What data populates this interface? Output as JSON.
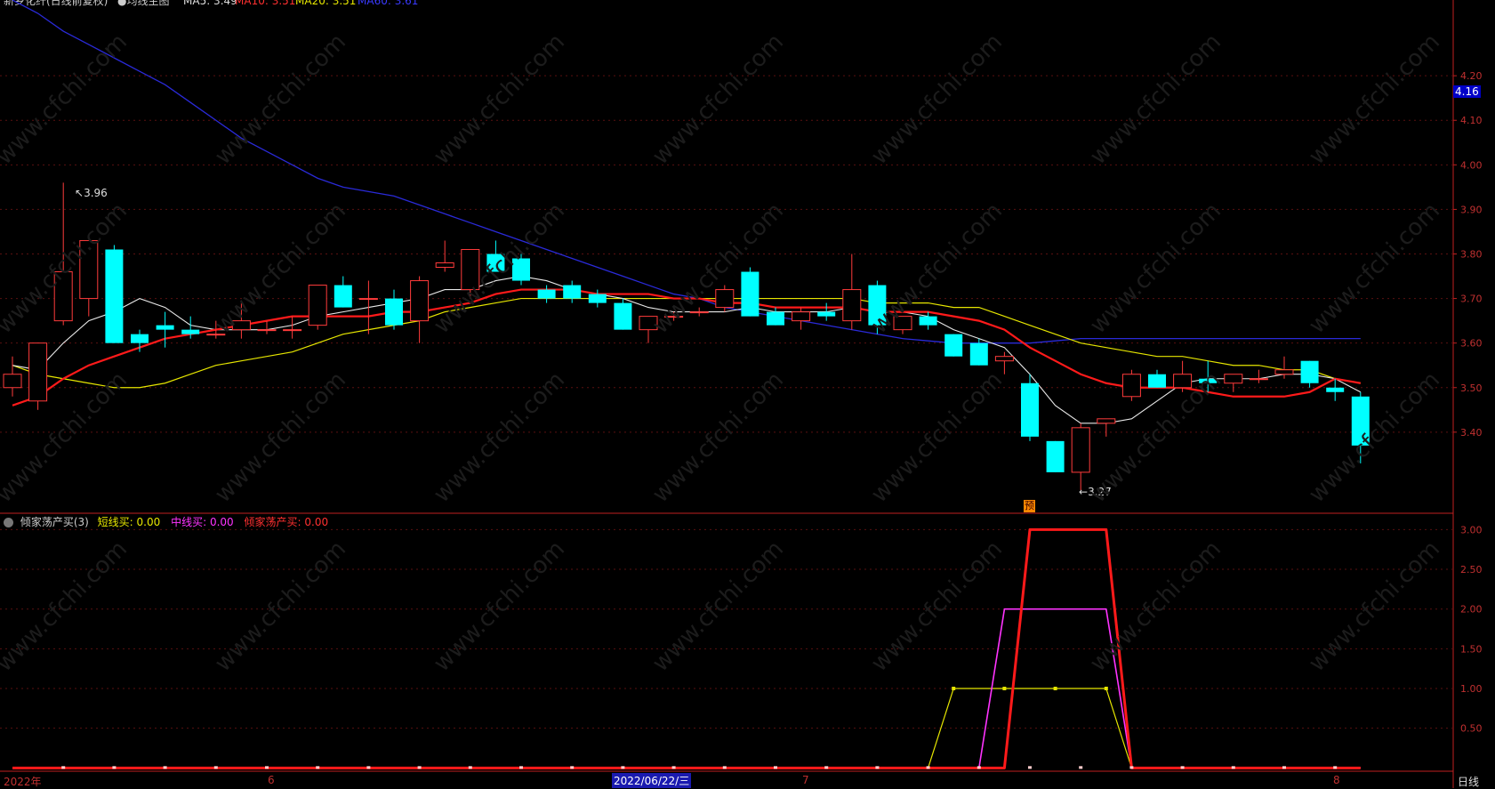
{
  "header": {
    "stock_title": "新乡化纤(日线前复权)",
    "ma_title": "●均线主图",
    "ma5_label": "MA5: 3.49",
    "ma10_label": "MA10: 3.51",
    "ma20_label": "MA20: 3.51",
    "ma60_label": "MA60: 3.61"
  },
  "price_tag": "4.16",
  "indicator": {
    "name": "倾家荡产买(3)",
    "s1_label": "短线买:",
    "s1_value": "0.00",
    "s2_label": "中线买:",
    "s2_value": "0.00",
    "s3_label": "倾家荡产买:",
    "s3_value": "0.00"
  },
  "x_axis": {
    "labels": [
      "2022年",
      "6",
      "2022/06/22/三",
      "7",
      "8"
    ],
    "period_label": "日线"
  },
  "annotations": {
    "high": "3.96",
    "low": "3.27",
    "marker": "预"
  },
  "watermark": "www.cfchi.com",
  "colors": {
    "up": "#ff3b3b",
    "down": "#00ffff",
    "ma5": "#e8e8e8",
    "ma10": "#ff1a1a",
    "ma20": "#e6e600",
    "ma60": "#2a2ad8",
    "ind_short": "#e6e600",
    "ind_mid": "#ff33ff",
    "ind_long": "#ff1a1a"
  },
  "chart_data": [
    {
      "type": "candlestick",
      "title": "",
      "y_axis_ticks": [
        3.4,
        3.5,
        3.6,
        3.7,
        3.8,
        3.9,
        4.0,
        4.1,
        4.2
      ],
      "ylim": [
        3.22,
        4.37
      ],
      "candles": [
        {
          "o": 3.5,
          "h": 3.57,
          "l": 3.48,
          "c": 3.53
        },
        {
          "o": 3.47,
          "h": 3.6,
          "l": 3.45,
          "c": 3.6
        },
        {
          "o": 3.65,
          "h": 3.96,
          "l": 3.64,
          "c": 3.76
        },
        {
          "o": 3.7,
          "h": 3.83,
          "l": 3.66,
          "c": 3.83
        },
        {
          "o": 3.81,
          "h": 3.82,
          "l": 3.6,
          "c": 3.6
        },
        {
          "o": 3.62,
          "h": 3.63,
          "l": 3.58,
          "c": 3.6
        },
        {
          "o": 3.64,
          "h": 3.67,
          "l": 3.59,
          "c": 3.63
        },
        {
          "o": 3.63,
          "h": 3.66,
          "l": 3.61,
          "c": 3.62
        },
        {
          "o": 3.62,
          "h": 3.65,
          "l": 3.61,
          "c": 3.62
        },
        {
          "o": 3.63,
          "h": 3.69,
          "l": 3.61,
          "c": 3.65
        },
        {
          "o": 3.63,
          "h": 3.65,
          "l": 3.62,
          "c": 3.63
        },
        {
          "o": 3.63,
          "h": 3.66,
          "l": 3.61,
          "c": 3.63
        },
        {
          "o": 3.64,
          "h": 3.73,
          "l": 3.63,
          "c": 3.73
        },
        {
          "o": 3.73,
          "h": 3.75,
          "l": 3.68,
          "c": 3.68
        },
        {
          "o": 3.7,
          "h": 3.74,
          "l": 3.62,
          "c": 3.7
        },
        {
          "o": 3.7,
          "h": 3.72,
          "l": 3.63,
          "c": 3.64
        },
        {
          "o": 3.65,
          "h": 3.75,
          "l": 3.6,
          "c": 3.74
        },
        {
          "o": 3.77,
          "h": 3.83,
          "l": 3.76,
          "c": 3.78
        },
        {
          "o": 3.72,
          "h": 3.81,
          "l": 3.7,
          "c": 3.81
        },
        {
          "o": 3.8,
          "h": 3.83,
          "l": 3.76,
          "c": 3.76
        },
        {
          "o": 3.79,
          "h": 3.8,
          "l": 3.73,
          "c": 3.74
        },
        {
          "o": 3.72,
          "h": 3.73,
          "l": 3.69,
          "c": 3.7
        },
        {
          "o": 3.73,
          "h": 3.74,
          "l": 3.69,
          "c": 3.7
        },
        {
          "o": 3.71,
          "h": 3.72,
          "l": 3.68,
          "c": 3.69
        },
        {
          "o": 3.69,
          "h": 3.7,
          "l": 3.63,
          "c": 3.63
        },
        {
          "o": 3.63,
          "h": 3.66,
          "l": 3.6,
          "c": 3.66
        },
        {
          "o": 3.66,
          "h": 3.67,
          "l": 3.65,
          "c": 3.66
        },
        {
          "o": 3.67,
          "h": 3.68,
          "l": 3.66,
          "c": 3.67
        },
        {
          "o": 3.68,
          "h": 3.73,
          "l": 3.67,
          "c": 3.72
        },
        {
          "o": 3.76,
          "h": 3.77,
          "l": 3.66,
          "c": 3.66
        },
        {
          "o": 3.67,
          "h": 3.68,
          "l": 3.64,
          "c": 3.64
        },
        {
          "o": 3.65,
          "h": 3.68,
          "l": 3.63,
          "c": 3.67
        },
        {
          "o": 3.67,
          "h": 3.69,
          "l": 3.65,
          "c": 3.66
        },
        {
          "o": 3.65,
          "h": 3.8,
          "l": 3.63,
          "c": 3.72
        },
        {
          "o": 3.73,
          "h": 3.74,
          "l": 3.62,
          "c": 3.64
        },
        {
          "o": 3.63,
          "h": 3.66,
          "l": 3.62,
          "c": 3.66
        },
        {
          "o": 3.66,
          "h": 3.67,
          "l": 3.63,
          "c": 3.64
        },
        {
          "o": 3.62,
          "h": 3.62,
          "l": 3.57,
          "c": 3.57
        },
        {
          "o": 3.6,
          "h": 3.61,
          "l": 3.55,
          "c": 3.55
        },
        {
          "o": 3.56,
          "h": 3.58,
          "l": 3.53,
          "c": 3.57
        },
        {
          "o": 3.51,
          "h": 3.53,
          "l": 3.38,
          "c": 3.39
        },
        {
          "o": 3.38,
          "h": 3.38,
          "l": 3.31,
          "c": 3.31
        },
        {
          "o": 3.31,
          "h": 3.42,
          "l": 3.27,
          "c": 3.41
        },
        {
          "o": 3.42,
          "h": 3.43,
          "l": 3.39,
          "c": 3.43
        },
        {
          "o": 3.48,
          "h": 3.54,
          "l": 3.47,
          "c": 3.53
        },
        {
          "o": 3.53,
          "h": 3.54,
          "l": 3.5,
          "c": 3.5
        },
        {
          "o": 3.5,
          "h": 3.56,
          "l": 3.49,
          "c": 3.53
        },
        {
          "o": 3.52,
          "h": 3.56,
          "l": 3.49,
          "c": 3.51
        },
        {
          "o": 3.51,
          "h": 3.53,
          "l": 3.49,
          "c": 3.53
        },
        {
          "o": 3.52,
          "h": 3.54,
          "l": 3.51,
          "c": 3.52
        },
        {
          "o": 3.53,
          "h": 3.57,
          "l": 3.52,
          "c": 3.54
        },
        {
          "o": 3.56,
          "h": 3.56,
          "l": 3.5,
          "c": 3.51
        },
        {
          "o": 3.5,
          "h": 3.52,
          "l": 3.47,
          "c": 3.49
        },
        {
          "o": 3.48,
          "h": 3.49,
          "l": 3.33,
          "c": 3.37
        }
      ],
      "ma5": [
        3.55,
        3.54,
        3.6,
        3.65,
        3.67,
        3.7,
        3.68,
        3.64,
        3.63,
        3.63,
        3.63,
        3.64,
        3.66,
        3.67,
        3.68,
        3.69,
        3.7,
        3.72,
        3.72,
        3.74,
        3.75,
        3.74,
        3.72,
        3.71,
        3.7,
        3.68,
        3.67,
        3.67,
        3.67,
        3.68,
        3.67,
        3.67,
        3.67,
        3.68,
        3.67,
        3.67,
        3.66,
        3.63,
        3.61,
        3.59,
        3.53,
        3.46,
        3.42,
        3.42,
        3.43,
        3.47,
        3.51,
        3.52,
        3.52,
        3.52,
        3.53,
        3.53,
        3.52,
        3.49
      ],
      "ma10": [
        3.46,
        3.48,
        3.52,
        3.55,
        3.57,
        3.59,
        3.61,
        3.62,
        3.63,
        3.64,
        3.65,
        3.66,
        3.66,
        3.66,
        3.66,
        3.67,
        3.67,
        3.68,
        3.69,
        3.71,
        3.72,
        3.72,
        3.72,
        3.71,
        3.71,
        3.71,
        3.7,
        3.7,
        3.69,
        3.69,
        3.68,
        3.68,
        3.68,
        3.68,
        3.67,
        3.67,
        3.67,
        3.66,
        3.65,
        3.63,
        3.59,
        3.56,
        3.53,
        3.51,
        3.5,
        3.5,
        3.5,
        3.49,
        3.48,
        3.48,
        3.48,
        3.49,
        3.52,
        3.51
      ],
      "ma20": [
        3.55,
        3.53,
        3.52,
        3.51,
        3.5,
        3.5,
        3.51,
        3.53,
        3.55,
        3.56,
        3.57,
        3.58,
        3.6,
        3.62,
        3.63,
        3.64,
        3.65,
        3.67,
        3.68,
        3.69,
        3.7,
        3.7,
        3.7,
        3.7,
        3.7,
        3.7,
        3.7,
        3.7,
        3.7,
        3.7,
        3.7,
        3.7,
        3.7,
        3.7,
        3.69,
        3.69,
        3.69,
        3.68,
        3.68,
        3.66,
        3.64,
        3.62,
        3.6,
        3.59,
        3.58,
        3.57,
        3.57,
        3.56,
        3.55,
        3.55,
        3.54,
        3.54,
        3.52,
        3.51
      ],
      "ma60": [
        4.37,
        4.34,
        4.3,
        4.27,
        4.24,
        4.21,
        4.18,
        4.14,
        4.1,
        4.06,
        4.03,
        4.0,
        3.97,
        3.95,
        3.94,
        3.93,
        3.91,
        3.89,
        3.87,
        3.85,
        3.83,
        3.81,
        3.79,
        3.77,
        3.75,
        3.73,
        3.71,
        3.7,
        3.68,
        3.67,
        3.66,
        3.65,
        3.64,
        3.63,
        3.62,
        3.61,
        3.605,
        3.6,
        3.6,
        3.6,
        3.6,
        3.605,
        3.61,
        3.61,
        3.61,
        3.61,
        3.61,
        3.61,
        3.61,
        3.61,
        3.61,
        3.61,
        3.61,
        3.61
      ]
    },
    {
      "type": "line",
      "title": "",
      "y_axis_ticks": [
        0.5,
        1.0,
        1.5,
        2.0,
        2.5,
        3.0
      ],
      "ylim": [
        -0.03,
        3.15
      ],
      "series": [
        {
          "name": "短线买",
          "x": [
            0,
            36,
            37,
            39,
            41,
            43,
            44,
            53
          ],
          "values": [
            0,
            0,
            1,
            1,
            1,
            1,
            0,
            0
          ]
        },
        {
          "name": "中线买",
          "x": [
            0,
            38,
            39,
            43,
            44,
            53
          ],
          "values": [
            0,
            0,
            2,
            2,
            0,
            0
          ]
        },
        {
          "name": "倾家荡产买",
          "x": [
            0,
            39,
            40,
            43,
            44,
            53
          ],
          "values": [
            0,
            0,
            3,
            3,
            0,
            0
          ]
        }
      ]
    }
  ]
}
